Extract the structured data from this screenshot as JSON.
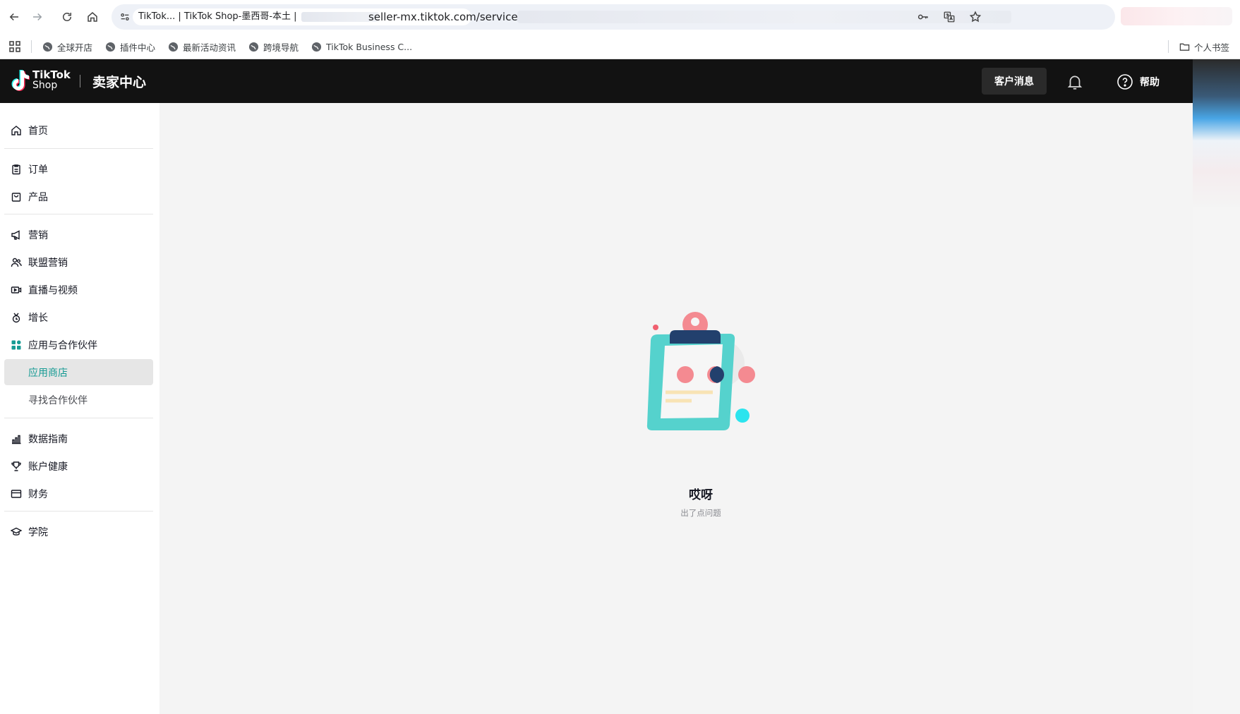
{
  "browser": {
    "tab_title": "TikTok... | TikTok Shop-墨西哥-本土 |",
    "url": "seller-mx.tiktok.com/services/",
    "bookmarks": [
      {
        "label": "全球开店",
        "icon": "globe-icon"
      },
      {
        "label": "插件中心",
        "icon": "globe-icon"
      },
      {
        "label": "最新活动资讯",
        "icon": "globe-icon"
      },
      {
        "label": "跨境导航",
        "icon": "globe-icon"
      },
      {
        "label": "TikTok Business C...",
        "icon": "globe-icon"
      }
    ],
    "bookmarks_folder": "个人书签"
  },
  "header": {
    "logo_line1": "TikTok",
    "logo_line2": "Shop",
    "title": "卖家中心",
    "customer_messages": "客户消息",
    "help": "帮助"
  },
  "sidebar": {
    "items": [
      {
        "label": "首页",
        "icon": "home-icon"
      },
      {
        "label": "订单",
        "icon": "clipboard-icon"
      },
      {
        "label": "产品",
        "icon": "bag-icon"
      },
      {
        "label": "营销",
        "icon": "megaphone-icon"
      },
      {
        "label": "联盟营销",
        "icon": "people-icon"
      },
      {
        "label": "直播与视频",
        "icon": "video-icon"
      },
      {
        "label": "增长",
        "icon": "growth-icon"
      },
      {
        "label": "应用与合作伙伴",
        "icon": "apps-grid-icon"
      },
      {
        "label": "应用商店",
        "icon": ""
      },
      {
        "label": "寻找合作伙伴",
        "icon": ""
      },
      {
        "label": "数据指南",
        "icon": "bar-chart-icon"
      },
      {
        "label": "账户健康",
        "icon": "trophy-icon"
      },
      {
        "label": "财务",
        "icon": "wallet-icon"
      },
      {
        "label": "学院",
        "icon": "graduation-cap-icon"
      }
    ],
    "active_item": "应用商店"
  },
  "main": {
    "empty_title": "哎呀",
    "empty_subtitle": "出了点问题"
  },
  "colors": {
    "header_bg": "#121212",
    "accent": "#179b94",
    "content_bg": "#f4f4f4"
  }
}
